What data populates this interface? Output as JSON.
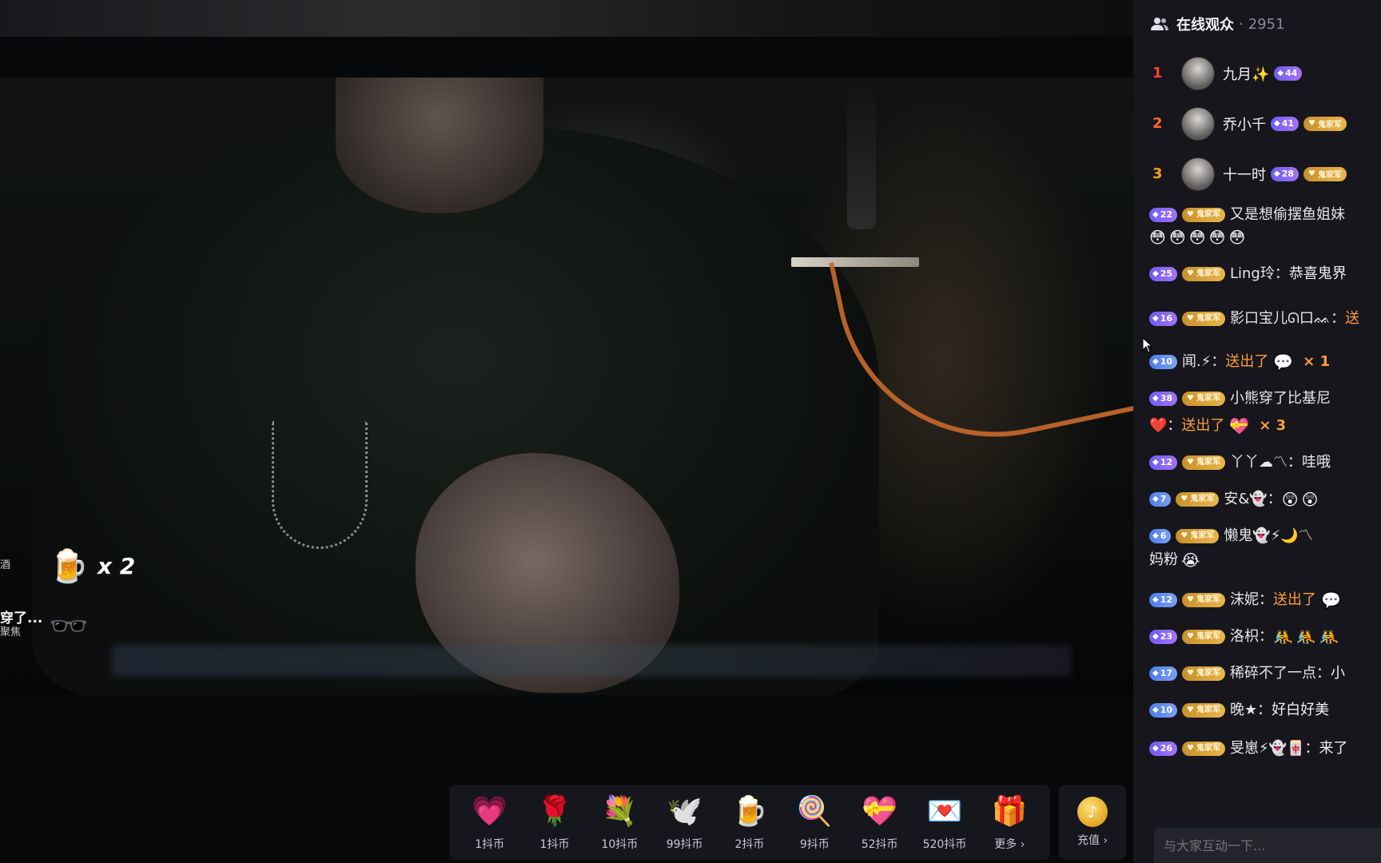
{
  "audience": {
    "title": "在线观众",
    "separator": "·",
    "count": "2951"
  },
  "ranking": [
    {
      "rank": "1",
      "name": "九月✨",
      "level": "44"
    },
    {
      "rank": "2",
      "name": "乔小千",
      "level": "41",
      "fan_badge": "鬼家军"
    },
    {
      "rank": "3",
      "name": "十一时",
      "level": "28",
      "fan_badge": "鬼家军"
    }
  ],
  "chat": [
    {
      "level": "22",
      "fan_badge": "鬼家军",
      "user": "又是想偷摆鱼姐妹",
      "text": "",
      "emojis": [
        "😳",
        "😳",
        "😳",
        "😳",
        "😳"
      ]
    },
    {
      "level": "25",
      "fan_badge": "鬼家军",
      "user": "Ling玲：",
      "text": "恭喜鬼界"
    },
    {
      "level": "16",
      "fan_badge": "鬼家军",
      "user": "影口宝儿ᘏ口ᨐ：",
      "sent": "送"
    },
    {
      "level": "10",
      "user": "闻.⚡：",
      "sent": "送出了",
      "gift_icon": "💬",
      "times": "× 1"
    },
    {
      "level": "38",
      "fan_badge": "鬼家军",
      "user": "小熊穿了比基尼",
      "line2_user": "❤️：",
      "sent": "送出了",
      "gift_icon": "💝",
      "times": "× 3"
    },
    {
      "level": "12",
      "fan_badge": "鬼家军",
      "user": "丫丫☁〽：",
      "text": "哇哦"
    },
    {
      "level": "7",
      "fan_badge": "鬼家军",
      "user": "安&👻：",
      "emojis": [
        "😲",
        "😲"
      ]
    },
    {
      "level": "6",
      "fan_badge": "鬼家军",
      "user": "懒鬼👻⚡🌙〽",
      "line2_text": "妈粉",
      "line2_emoji": "😭"
    },
    {
      "level": "12",
      "fan_badge": "鬼家军",
      "user": "沫妮：",
      "sent": "送出了",
      "gift_icon": "💬"
    },
    {
      "level": "23",
      "fan_badge": "鬼家军",
      "user": "洛枳：",
      "emojis": [
        "🤼",
        "🤼",
        "🤼"
      ]
    },
    {
      "level": "17",
      "fan_badge": "鬼家军",
      "user": "稀碎不了一点：",
      "text": "小"
    },
    {
      "level": "10",
      "fan_badge": "鬼家军",
      "user": "晚★：",
      "text": "好白好美"
    },
    {
      "level": "26",
      "fan_badge": "鬼家军",
      "user": "旻崽⚡👻🀄：",
      "text": "来了"
    }
  ],
  "chat_input": {
    "placeholder": "与大家互动一下..."
  },
  "gift_effects": [
    {
      "name": "",
      "sub": "酒",
      "icon": "🍺",
      "count": "x 2"
    },
    {
      "name": "穿了...",
      "sub": "聚焦",
      "icon": "🕶️"
    }
  ],
  "gifts": [
    {
      "icon": "💗",
      "price": "1抖币"
    },
    {
      "icon": "🌹",
      "price": "1抖币"
    },
    {
      "icon": "💐",
      "price": "10抖币"
    },
    {
      "icon": "🕊️",
      "price": "99抖币"
    },
    {
      "icon": "🍺",
      "price": "2抖币"
    },
    {
      "icon": "🍭",
      "price": "9抖币"
    },
    {
      "icon": "💝",
      "price": "52抖币"
    },
    {
      "icon": "💌",
      "price": "520抖币"
    },
    {
      "icon": "🎁",
      "price": "更多 ›"
    }
  ],
  "recharge": {
    "icon": "♪",
    "label": "充值 ›"
  },
  "colors": {
    "rank1": "#ff4040",
    "rank2": "#ff6a2a",
    "rank3": "#f2a020",
    "sent": "#ff9e3d",
    "level_badge": "#8a6cf5",
    "fan_badge": "#d9a33c"
  }
}
